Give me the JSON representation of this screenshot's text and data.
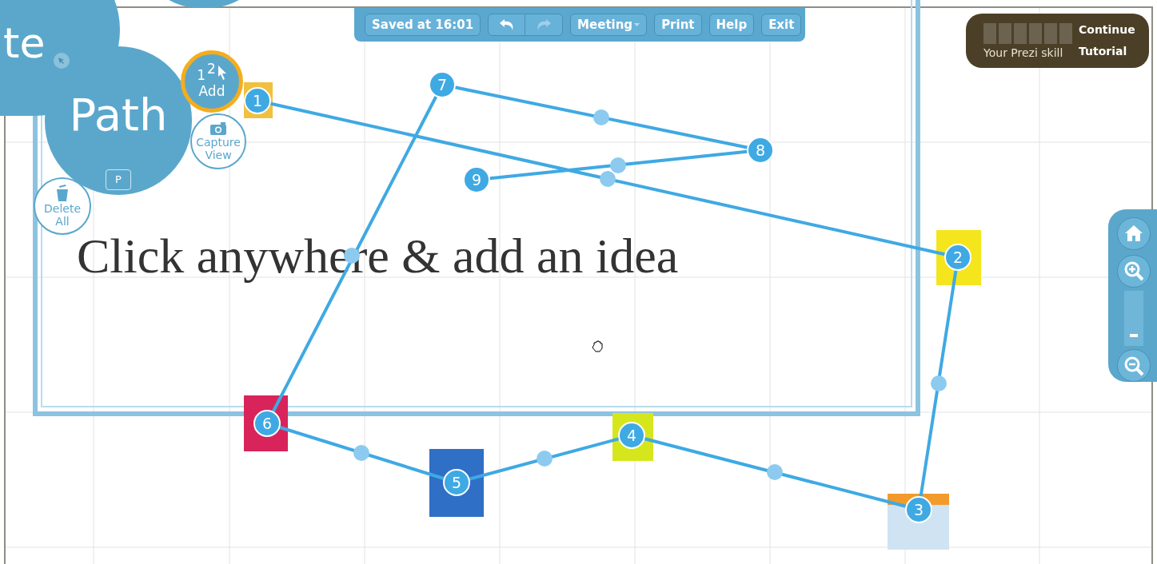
{
  "toolbar": {
    "saved_status": "Saved at 16:01",
    "undo": {
      "disabled": false
    },
    "redo": {
      "disabled": true
    },
    "buttons": [
      {
        "label": "Meeting",
        "kind": "dropdown"
      },
      {
        "label": "Print",
        "kind": "button"
      },
      {
        "label": "Help",
        "kind": "button"
      },
      {
        "label": "Exit",
        "kind": "button"
      }
    ]
  },
  "skill": {
    "segments": [
      {
        "filled": false
      },
      {
        "filled": false
      },
      {
        "filled": false
      },
      {
        "filled": false
      },
      {
        "filled": false
      },
      {
        "filled": false
      }
    ],
    "label": "Your Prezi skill",
    "continue_button": "Continue Tutorial"
  },
  "zebra": {
    "partial_label": "te",
    "main_label": "Path",
    "shortcut_key": "P",
    "add_button": {
      "label": "Add",
      "digits": [
        "1",
        "2"
      ]
    },
    "capture_button": "Capture View",
    "delete_button": "Delete All"
  },
  "canvas": {
    "placeholder_text": "Click anywhere & add an idea",
    "path_points": [
      {
        "label": "1"
      },
      {
        "label": "2"
      },
      {
        "label": "3"
      },
      {
        "label": "4"
      },
      {
        "label": "5"
      },
      {
        "label": "6"
      },
      {
        "label": "7"
      },
      {
        "label": "8"
      },
      {
        "label": "9"
      }
    ]
  },
  "zoom": {
    "level": 0.2
  }
}
